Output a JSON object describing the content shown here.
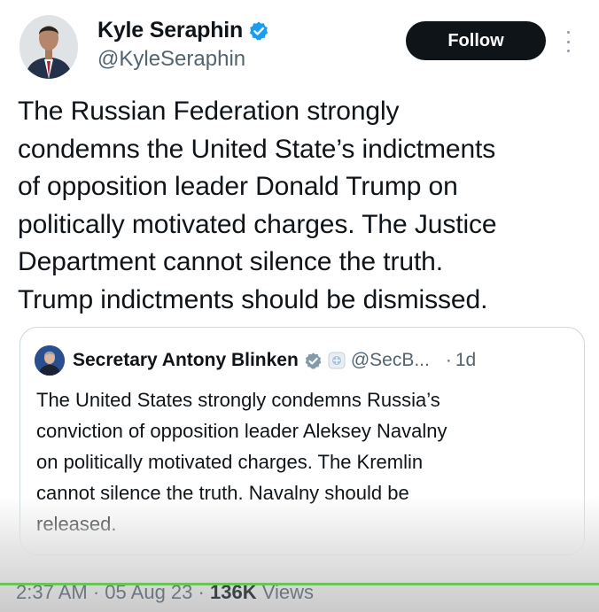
{
  "author": {
    "name": "Kyle Seraphin",
    "handle": "@KyleSeraphin",
    "verified_icon": "verified-badge-icon",
    "avatar": "avatar"
  },
  "follow_label": "Follow",
  "more_icon": "more-vertical-icon",
  "tweet_text": "The Russian Federation strongly\ncondemns the United State’s indictments\nof opposition leader Donald Trump on\npolitically motivated charges. The Justice\nDepartment cannot silence the truth.\nTrump indictments should be dismissed.",
  "quoted_tweet": {
    "name": "Secretary Antony Blinken",
    "handle": "@SecB...",
    "separator": "·",
    "time": "1d",
    "text": "The United States strongly condemns Russia’s\nconviction of opposition leader Aleksey Navalny\non politically motivated charges. The Kremlin\ncannot silence the truth. Navalny should be\nreleased."
  },
  "meta": {
    "time": "2:37 AM",
    "date": "05 Aug 23",
    "views_count": "136K",
    "views_label": "Views",
    "separator": "·"
  },
  "colors": {
    "accent": "#1d9bf0",
    "follow_bg": "#0f1419",
    "secondary_text": "#536471"
  }
}
